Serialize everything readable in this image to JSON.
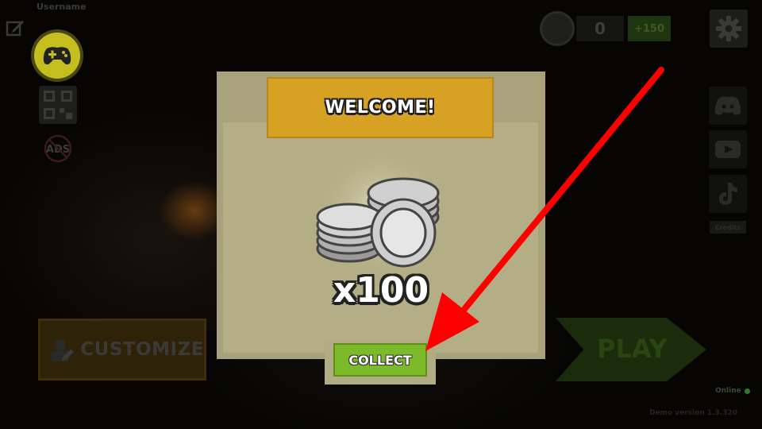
{
  "hud": {
    "username": "Username",
    "coins": "0",
    "coin_bonus": "+150",
    "credits_label": "Credits",
    "online_label": "Online",
    "version": "Demo version 1.3.320"
  },
  "menu": {
    "customize_label": "CUSTOMIZE",
    "play_label": "PLAY"
  },
  "modal": {
    "title": "WELCOME!",
    "reward_amount": "x100",
    "collect_label": "COLLECT"
  },
  "icons": {
    "edit": "edit-icon",
    "gamepad": "gamepad-icon",
    "qr": "qr-code-icon",
    "no_ads": "no-ads-icon",
    "coin": "coin-icon",
    "settings": "gear-icon",
    "discord": "discord-icon",
    "youtube": "youtube-icon",
    "tiktok": "tiktok-icon",
    "reward": "silver-coins-icon",
    "annotation": "red-arrow"
  },
  "colors": {
    "modal_header": "#d7a124",
    "modal_body": "#b3ae85",
    "collect_button": "#7cba2a",
    "gamepad_button": "#c4be1f",
    "arrow": "#ff0000"
  }
}
